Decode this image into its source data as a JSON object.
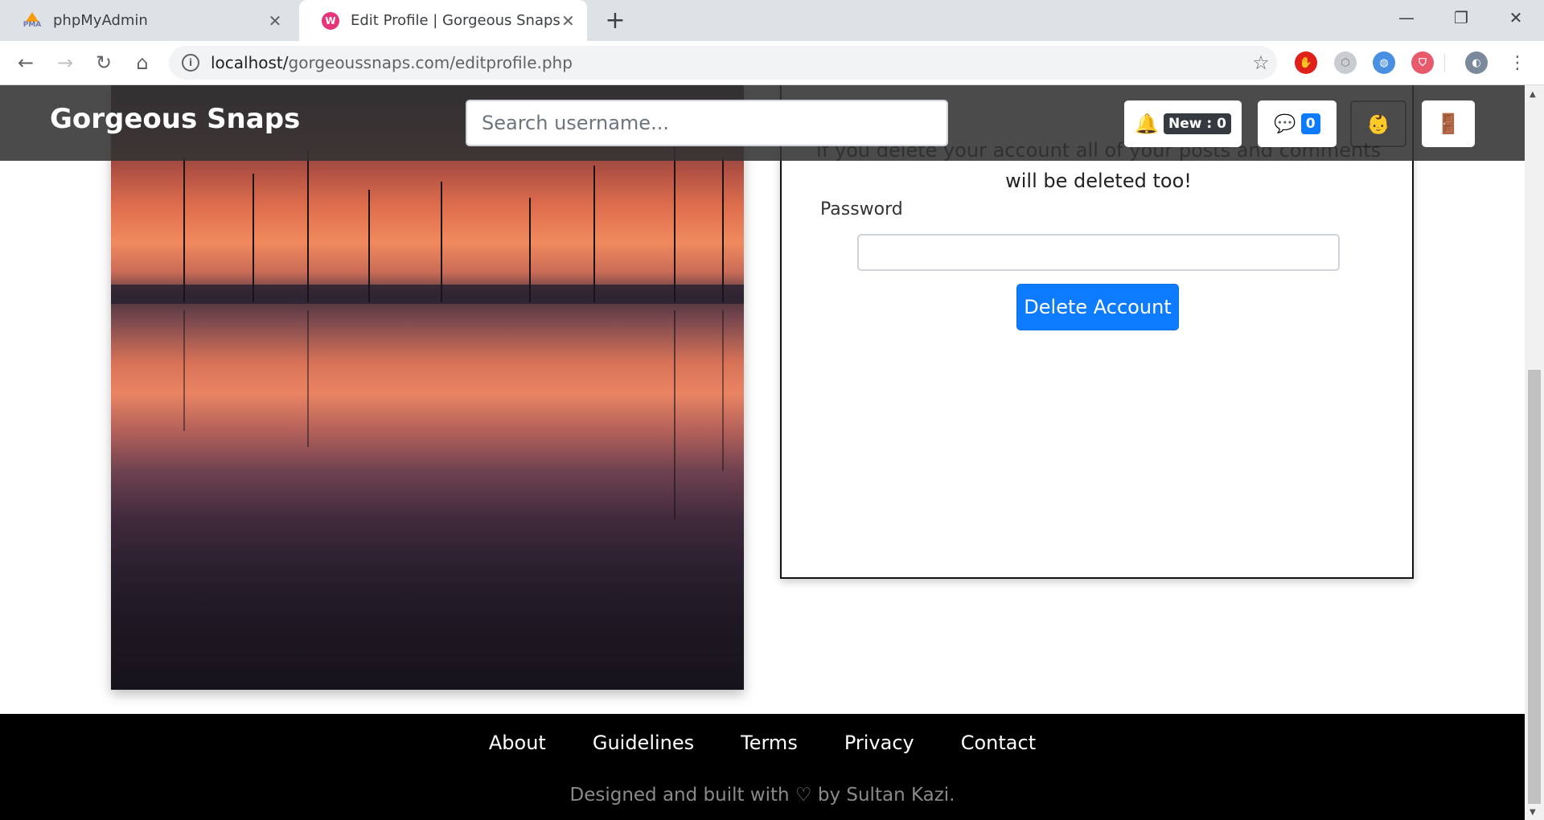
{
  "browser": {
    "tabs": [
      {
        "title": "phpMyAdmin",
        "active": false,
        "icon": "phpmyadmin-icon"
      },
      {
        "title": "Edit Profile | Gorgeous Snaps",
        "active": true,
        "icon": "wampserver-icon"
      }
    ],
    "new_tab_symbol": "+",
    "url_host": "localhost/",
    "url_path": "gorgeoussnaps.com/editprofile.php"
  },
  "site": {
    "brand": "Gorgeous Snaps",
    "search_placeholder": "Search username...",
    "notifications_label": "New : 0",
    "messages_count": "0",
    "profile_emoji": "👶",
    "logout_emoji": "🚪"
  },
  "delete_card": {
    "message": "If you delete your account all of your posts and comments will be deleted too!",
    "password_label": "Password",
    "password_value": "",
    "delete_button": "Delete Account"
  },
  "footer": {
    "links": [
      "About",
      "Guidelines",
      "Terms",
      "Privacy",
      "Contact"
    ],
    "credit": "Designed and built with ♡ by Sultan Kazi."
  },
  "colors": {
    "primary": "#0d7bff",
    "navbar": "#323232",
    "footer": "#000000"
  }
}
